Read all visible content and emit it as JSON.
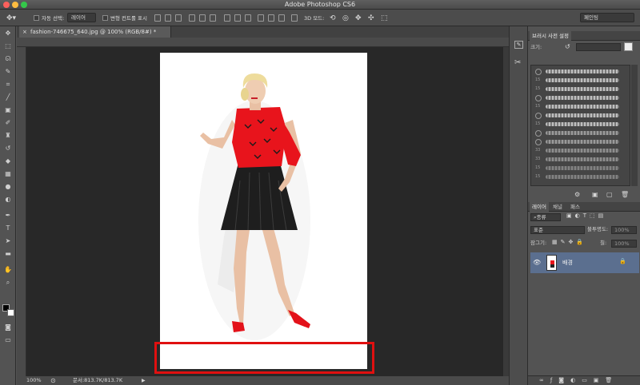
{
  "window": {
    "title": "Adobe Photoshop CS6"
  },
  "options_bar": {
    "auto_select_label": "자동 선택:",
    "auto_select_value": "레이어",
    "transform_label": "변형 컨트롤 표시",
    "mode_3d_label": "3D 모드:",
    "workspace": "페인팅"
  },
  "document": {
    "tab_title": "fashion-746675_640.jpg @ 100% (RGB/8#) *",
    "zoom": "100%",
    "doc_size": "문서:813.7K/813.7K"
  },
  "brush_panel": {
    "title": "브러시 사전 설정",
    "size_label": "크기:",
    "sizes": [
      "",
      "",
      "",
      "",
      "",
      "",
      "",
      "",
      "",
      "",
      "",
      "",
      "",
      ""
    ],
    "numbers": [
      "15",
      "15",
      "15",
      "15",
      "15",
      "15",
      "15",
      "15",
      "15",
      "15",
      "15",
      "33",
      "33",
      "15",
      "15"
    ]
  },
  "layers_panel": {
    "tabs": [
      "레이어",
      "채널",
      "패스"
    ],
    "filter_label": "종류",
    "blend_mode": "표준",
    "opacity_label": "불투명도:",
    "opacity_value": "100%",
    "lock_label": "잠그기:",
    "fill_label": "칠:",
    "fill_value": "100%",
    "layers": [
      {
        "name": "배경"
      }
    ]
  },
  "colors": {
    "highlight": "#e01010",
    "selected_layer": "#5b6f8f",
    "sweater": "#e8141c"
  }
}
